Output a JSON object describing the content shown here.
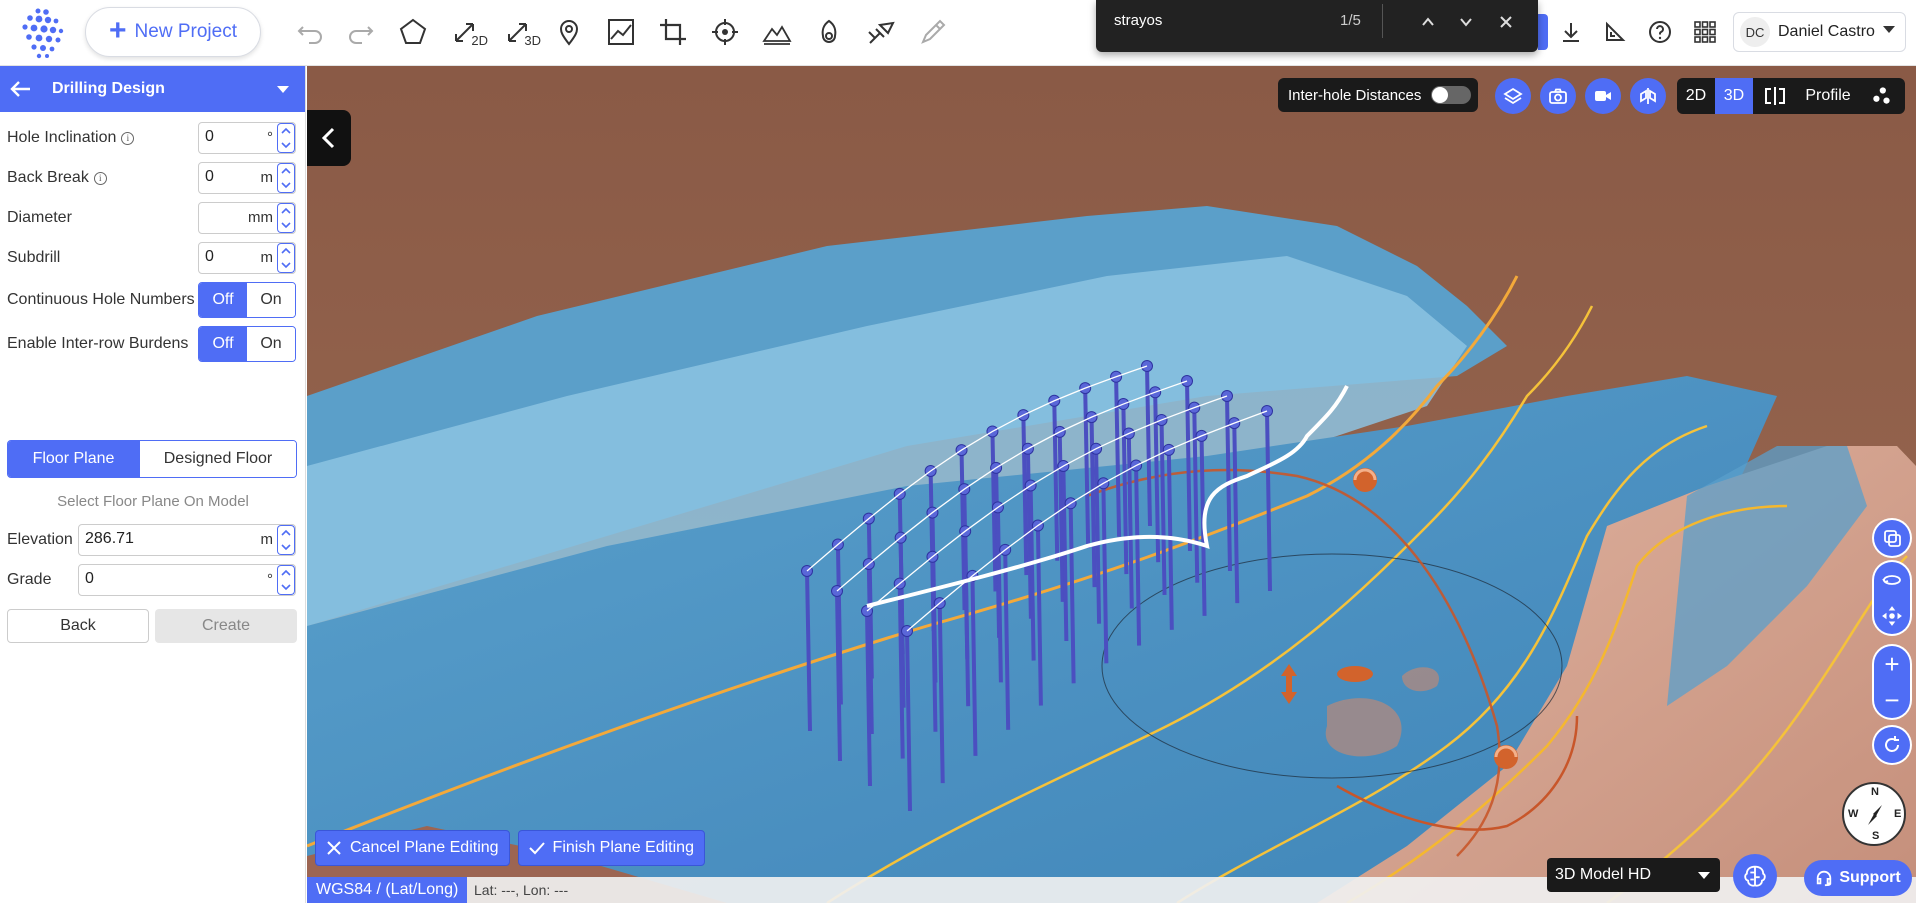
{
  "toolbar": {
    "new_project_label": "New Project",
    "tools": [
      "undo-icon",
      "redo-icon",
      "polygon-icon",
      "measure-2d-icon",
      "measure-3d-icon",
      "location-pin-icon",
      "profile-chart-icon",
      "crop-icon",
      "target-icon",
      "terrain-icon",
      "blast-icon",
      "drill-icon",
      "pen-icon"
    ],
    "tool_subs": {
      "measure2d": "2D",
      "measure3d": "3D"
    }
  },
  "find_bar": {
    "query": "strayos",
    "count": "1/5"
  },
  "user": {
    "initials": "DC",
    "name": "Daniel Castro"
  },
  "panel": {
    "title": "Drilling Design",
    "hole_inclination": {
      "label": "Hole Inclination",
      "value": "0",
      "unit": "°"
    },
    "back_break": {
      "label": "Back Break",
      "value": "0",
      "unit": "m"
    },
    "diameter": {
      "label": "Diameter",
      "value": "",
      "unit": "mm"
    },
    "subdrill": {
      "label": "Subdrill",
      "value": "0",
      "unit": "m"
    },
    "continuous_hole_numbers": {
      "label": "Continuous Hole Numbers",
      "off": "Off",
      "on": "On",
      "selected": "Off"
    },
    "enable_interrow_burdens": {
      "label": "Enable Inter-row Burdens",
      "off": "Off",
      "on": "On",
      "selected": "Off"
    },
    "floor_tabs": {
      "a": "Floor Plane",
      "b": "Designed Floor",
      "selected": "Floor Plane"
    },
    "select_hint": "Select Floor Plane On Model",
    "elevation": {
      "label": "Elevation",
      "value": "286.71",
      "unit": "m"
    },
    "grade": {
      "label": "Grade",
      "value": "0",
      "unit": "°"
    },
    "back_label": "Back",
    "create_label": "Create"
  },
  "viewport": {
    "inter_hole_label": "Inter-hole Distances",
    "inter_hole_enabled": false,
    "view_modes": {
      "m2d": "2D",
      "m3d": "3D",
      "profile": "Profile",
      "selected": "3D"
    },
    "cancel_label": "Cancel Plane Editing",
    "finish_label": "Finish Plane Editing",
    "crs_label": "WGS84 / (Lat/Long)",
    "latlon": "Lat: ---, Lon: ---",
    "model_label": "3D Model HD",
    "support_label": "Support",
    "compass": {
      "n": "N",
      "e": "E",
      "s": "S",
      "w": "W"
    }
  },
  "colors": {
    "accent": "#4f6df5",
    "terrain_blue": "#4a8fc0",
    "rock": "#d6a592",
    "contour": "#f5b82e",
    "hole": "#4b4fc0",
    "handle": "#d2632c"
  }
}
